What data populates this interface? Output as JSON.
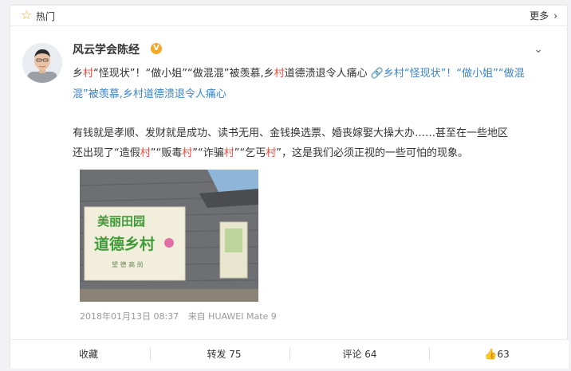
{
  "hot": {
    "label": "热门",
    "more": "更多"
  },
  "post": {
    "author": "风云学会陈经",
    "verified_badge": "V",
    "title_line1": [
      {
        "t": "乡",
        "c": ""
      },
      {
        "t": "村",
        "c": "r"
      },
      {
        "t": "“怪现状”！“做小姐”“做混混”被羡慕,乡",
        "c": ""
      },
      {
        "t": "村",
        "c": "r"
      },
      {
        "t": "道德溃退令人痛心 ",
        "c": ""
      },
      {
        "t": "🔗乡",
        "c": "l"
      },
      {
        "t": "村",
        "c": "lr"
      },
      {
        "t": "“怪现状”！“做小姐”“做混",
        "c": "l"
      }
    ],
    "title_line2": [
      {
        "t": "混”被羡慕,乡",
        "c": "l"
      },
      {
        "t": "村",
        "c": "lr"
      },
      {
        "t": "道德溃退令人痛心",
        "c": "l"
      }
    ],
    "body_line1": [
      {
        "t": "有钱就是孝顺、发财就是成功、读书无用、金钱换选票、婚丧嫁娶大操大办……甚至在一些地区",
        "c": ""
      }
    ],
    "body_line2": [
      {
        "t": "还出现了“造假",
        "c": ""
      },
      {
        "t": "村",
        "c": "r"
      },
      {
        "t": "”“贩毒",
        "c": ""
      },
      {
        "t": "村",
        "c": "r"
      },
      {
        "t": "”“诈骗",
        "c": ""
      },
      {
        "t": "村",
        "c": "r"
      },
      {
        "t": "”“乞丐",
        "c": ""
      },
      {
        "t": "村",
        "c": "r"
      },
      {
        "t": "”，这是我们必须正视的一些可怕的现象。",
        "c": ""
      }
    ],
    "image_text": {
      "line1": "美丽田园",
      "line2": "道德乡村",
      "line3": "望 德 高 尚"
    },
    "timestamp": "2018年01月13日 08:37",
    "source": "来自 HUAWEI Mate 9"
  },
  "actions": {
    "favorite": "收藏",
    "repost": "转发 75",
    "comment": "评论 64",
    "like_count": "63"
  },
  "colors": {
    "accent_red": "#e74c3c",
    "link_blue": "#3a83c8",
    "star": "#f3a92a"
  }
}
